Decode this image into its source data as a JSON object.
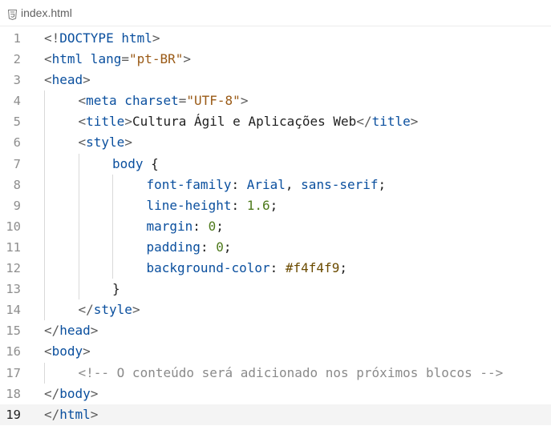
{
  "tab": {
    "filename": "index.html",
    "icon": "html5-file-icon"
  },
  "editor": {
    "current_line": 19,
    "lines": [
      {
        "n": "1",
        "indent": 0,
        "tokens": [
          [
            "p",
            "<!"
          ],
          [
            "t",
            "DOCTYPE"
          ],
          [
            "t",
            " html"
          ],
          [
            "p",
            ">"
          ]
        ]
      },
      {
        "n": "2",
        "indent": 0,
        "tokens": [
          [
            "p",
            "<"
          ],
          [
            "t",
            "html"
          ],
          [
            "a",
            " lang"
          ],
          [
            "p",
            "="
          ],
          [
            "s",
            "\"pt-BR\""
          ],
          [
            "p",
            ">"
          ]
        ]
      },
      {
        "n": "3",
        "indent": 0,
        "tokens": [
          [
            "p",
            "<"
          ],
          [
            "t",
            "head"
          ],
          [
            "p",
            ">"
          ]
        ]
      },
      {
        "n": "4",
        "indent": 1,
        "tokens": [
          [
            "p",
            "<"
          ],
          [
            "t",
            "meta"
          ],
          [
            "a",
            " charset"
          ],
          [
            "p",
            "="
          ],
          [
            "s",
            "\"UTF-8\""
          ],
          [
            "p",
            ">"
          ]
        ]
      },
      {
        "n": "5",
        "indent": 1,
        "tokens": [
          [
            "p",
            "<"
          ],
          [
            "t",
            "title"
          ],
          [
            "p",
            ">"
          ],
          [
            "txt",
            "Cultura Ágil e Aplicações Web"
          ],
          [
            "p",
            "</"
          ],
          [
            "t",
            "title"
          ],
          [
            "p",
            ">"
          ]
        ]
      },
      {
        "n": "6",
        "indent": 1,
        "tokens": [
          [
            "p",
            "<"
          ],
          [
            "t",
            "style"
          ],
          [
            "p",
            ">"
          ]
        ]
      },
      {
        "n": "7",
        "indent": 2,
        "tokens": [
          [
            "sel",
            "body"
          ],
          [
            "txt",
            " {"
          ]
        ]
      },
      {
        "n": "8",
        "indent": 3,
        "tokens": [
          [
            "prop",
            "font-family"
          ],
          [
            "txt",
            ": "
          ],
          [
            "val",
            "Arial"
          ],
          [
            "txt",
            ", "
          ],
          [
            "val",
            "sans-serif"
          ],
          [
            "txt",
            ";"
          ]
        ]
      },
      {
        "n": "9",
        "indent": 3,
        "tokens": [
          [
            "prop",
            "line-height"
          ],
          [
            "txt",
            ": "
          ],
          [
            "num",
            "1.6"
          ],
          [
            "txt",
            ";"
          ]
        ]
      },
      {
        "n": "10",
        "indent": 3,
        "tokens": [
          [
            "prop",
            "margin"
          ],
          [
            "txt",
            ": "
          ],
          [
            "num",
            "0"
          ],
          [
            "txt",
            ";"
          ]
        ]
      },
      {
        "n": "11",
        "indent": 3,
        "tokens": [
          [
            "prop",
            "padding"
          ],
          [
            "txt",
            ": "
          ],
          [
            "num",
            "0"
          ],
          [
            "txt",
            ";"
          ]
        ]
      },
      {
        "n": "12",
        "indent": 3,
        "tokens": [
          [
            "prop",
            "background-color"
          ],
          [
            "txt",
            ": "
          ],
          [
            "col",
            "#f4f4f9"
          ],
          [
            "txt",
            ";"
          ]
        ]
      },
      {
        "n": "13",
        "indent": 2,
        "tokens": [
          [
            "txt",
            "}"
          ]
        ]
      },
      {
        "n": "14",
        "indent": 1,
        "tokens": [
          [
            "p",
            "</"
          ],
          [
            "t",
            "style"
          ],
          [
            "p",
            ">"
          ]
        ]
      },
      {
        "n": "15",
        "indent": 0,
        "tokens": [
          [
            "p",
            "</"
          ],
          [
            "t",
            "head"
          ],
          [
            "p",
            ">"
          ]
        ]
      },
      {
        "n": "16",
        "indent": 0,
        "tokens": [
          [
            "p",
            "<"
          ],
          [
            "t",
            "body"
          ],
          [
            "p",
            ">"
          ]
        ]
      },
      {
        "n": "17",
        "indent": 1,
        "tokens": [
          [
            "cm",
            "<!-- O conteúdo será adicionado nos próximos blocos -->"
          ]
        ]
      },
      {
        "n": "18",
        "indent": 0,
        "tokens": [
          [
            "p",
            "</"
          ],
          [
            "t",
            "body"
          ],
          [
            "p",
            ">"
          ]
        ]
      },
      {
        "n": "19",
        "indent": 0,
        "tokens": [
          [
            "p",
            "</"
          ],
          [
            "t",
            "html"
          ],
          [
            "p",
            ">"
          ]
        ]
      }
    ]
  }
}
